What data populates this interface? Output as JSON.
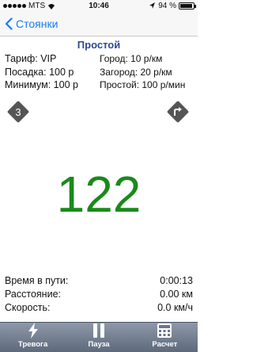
{
  "status_bar": {
    "carrier": "MTS",
    "time": "10:46",
    "battery_text": "94 %",
    "battery_level": 0.94
  },
  "nav": {
    "back_label": "Стоянки"
  },
  "screen_title": "Простой",
  "tariff_info": [
    {
      "left": "Тариф: VIP",
      "right": "Город: 10 р/км"
    },
    {
      "left": "Посадка: 100 р",
      "right": "Загород: 20 р/км"
    },
    {
      "left": "Минимум: 100 р",
      "right": "Простой: 100 р/мин"
    }
  ],
  "buttons": {
    "left_badge": "3",
    "left_icon": "number-3-diamond-icon",
    "right_icon": "turn-right-diamond-icon"
  },
  "counter_value": "122",
  "stats": [
    {
      "label": "Время в пути:",
      "value": "0:00:13"
    },
    {
      "label": "Расстояние:",
      "value": "0.00 км"
    },
    {
      "label": "Скорость:",
      "value": "0.0 км/ч"
    }
  ],
  "tabs": [
    {
      "label": "Тревога",
      "icon": "lightning-icon"
    },
    {
      "label": "Пауза",
      "icon": "pause-icon"
    },
    {
      "label": "Расчет",
      "icon": "calculator-icon"
    }
  ],
  "colors": {
    "accent": "#1a7cf3",
    "title": "#2a4a8f",
    "counter": "#1a8a1a",
    "tab_bar": "#6b7788"
  }
}
